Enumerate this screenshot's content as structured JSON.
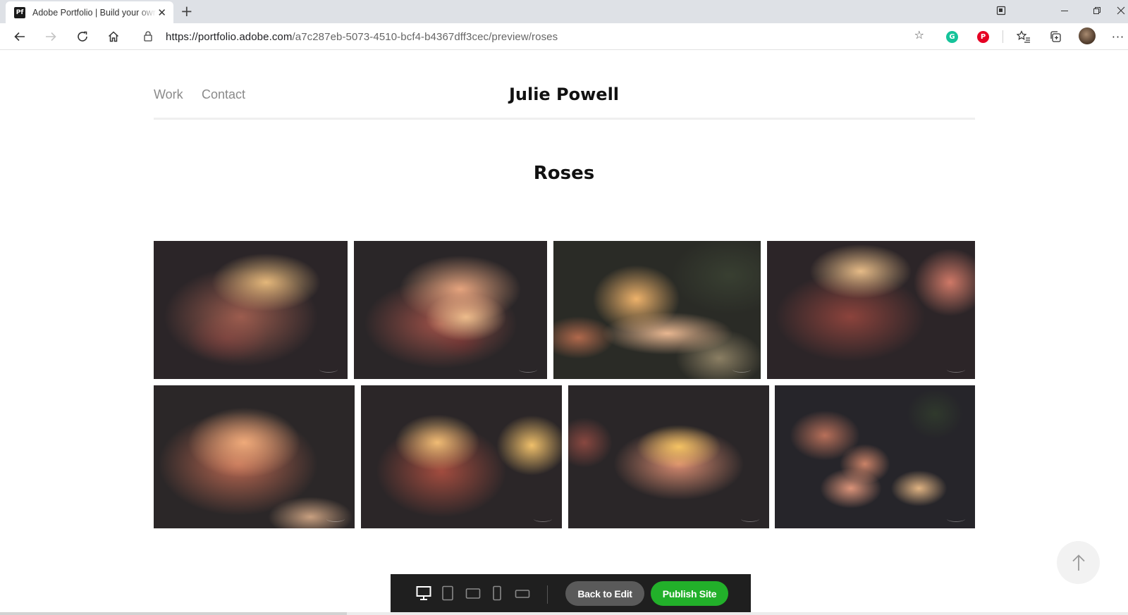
{
  "browser": {
    "tab_title": "Adobe Portfolio | Build your own personalized website",
    "favicon_text": "Pf",
    "url_host": "https://portfolio.adobe.com",
    "url_path": "/a7c287eb-5073-4510-bcf4-b4367dff3cec/preview/roses"
  },
  "site": {
    "nav": [
      "Work",
      "Contact"
    ],
    "title": "Julie Powell"
  },
  "page": {
    "title": "Roses"
  },
  "preview_bar": {
    "back_label": "Back to Edit",
    "publish_label": "Publish Site"
  },
  "colors": {
    "publish": "#22b02a",
    "grammarly": "#15c39a",
    "pinterest": "#e60023"
  }
}
